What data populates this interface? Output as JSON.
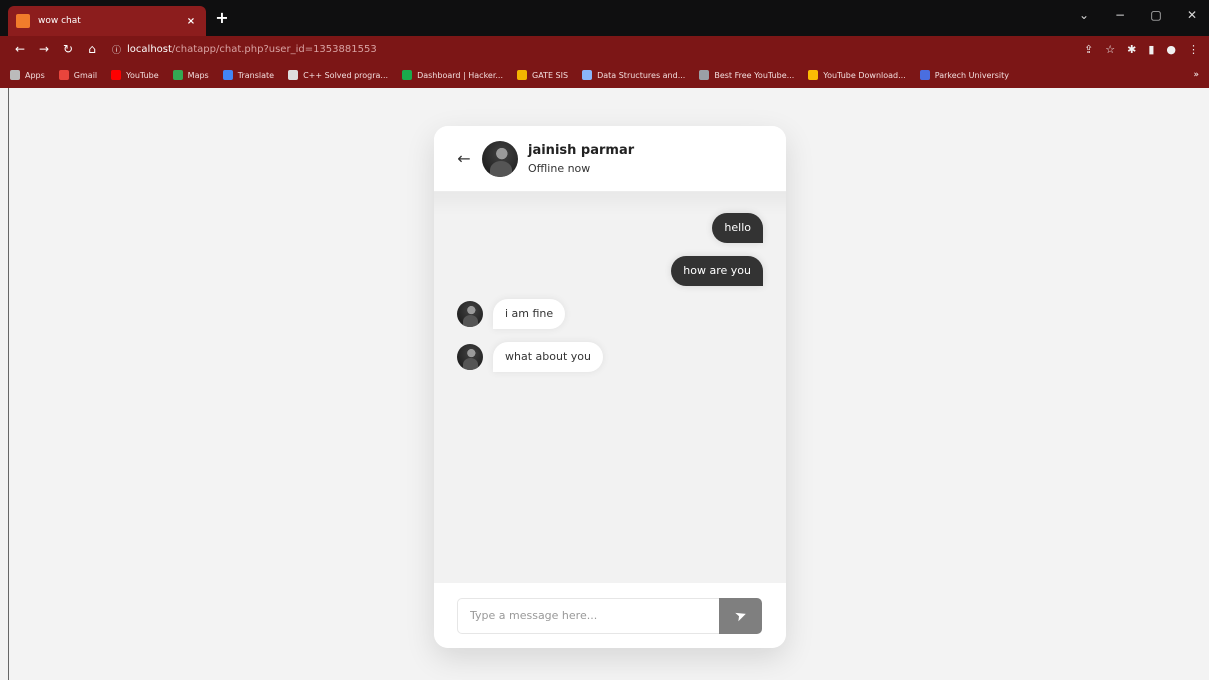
{
  "browser": {
    "tab_title": "wow chat",
    "tab_close": "×",
    "new_tab": "+",
    "window_controls": [
      "⌄",
      "−",
      "▢",
      "✕"
    ],
    "nav": {
      "back": "←",
      "forward": "→",
      "reload": "↻",
      "home": "⌂"
    },
    "url_info": "ⓘ",
    "url_host": "localhost",
    "url_path": "/chatapp/chat.php?user_id=1353881553",
    "right_icons": [
      "⇪",
      "☆",
      "✱",
      "▮",
      "●",
      "⋮"
    ],
    "bookmarks": [
      {
        "label": "Apps",
        "color": "#bbbbbb"
      },
      {
        "label": "Gmail",
        "color": "#e8453c"
      },
      {
        "label": "YouTube",
        "color": "#ff0000"
      },
      {
        "label": "Maps",
        "color": "#34a853"
      },
      {
        "label": "Translate",
        "color": "#4285f4"
      },
      {
        "label": "C++ Solved progra...",
        "color": "#dddddd"
      },
      {
        "label": "Dashboard | Hacker...",
        "color": "#1ba94c"
      },
      {
        "label": "GATE SIS",
        "color": "#f4b400"
      },
      {
        "label": "Data Structures and...",
        "color": "#8ab4f8"
      },
      {
        "label": "Best Free YouTube...",
        "color": "#9aa0a6"
      },
      {
        "label": "YouTube Download...",
        "color": "#fbbc04"
      },
      {
        "label": "Parkech University",
        "color": "#4a6ee0"
      }
    ],
    "bookmarks_more": "»"
  },
  "chat": {
    "back_icon": "←",
    "user_name": "jainish parmar",
    "user_status": "Offline now",
    "messages": [
      {
        "direction": "outgoing",
        "text": "hello"
      },
      {
        "direction": "outgoing",
        "text": "how are you"
      },
      {
        "direction": "incoming",
        "text": "i am fine"
      },
      {
        "direction": "incoming",
        "text": "what about you"
      }
    ],
    "input_placeholder": "Type a message here...",
    "send_icon": "➤"
  }
}
